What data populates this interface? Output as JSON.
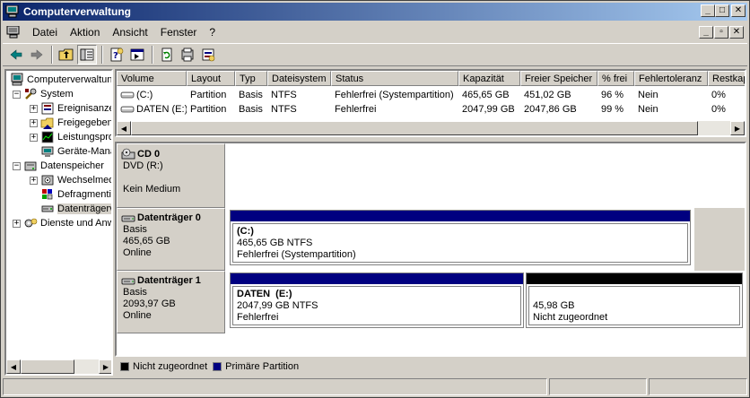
{
  "window": {
    "title": "Computerverwaltung",
    "controls": {
      "minimize": "_",
      "maximize": "□",
      "close": "✕"
    },
    "mdi_controls": {
      "minimize": "_",
      "restore": "▫",
      "close": "✕"
    }
  },
  "menu": [
    "Datei",
    "Aktion",
    "Ansicht",
    "Fenster",
    "?"
  ],
  "toolbar_icons": [
    "back-icon",
    "forward-icon",
    "up-folder-icon",
    "show-tree-icon",
    "properties-icon",
    "export-icon",
    "refresh-icon",
    "help-icon",
    "settings-icon"
  ],
  "tree": {
    "items": [
      {
        "label": "Computerverwaltung (Lokal)",
        "level": 0,
        "expander": "",
        "icon": "computer-icon"
      },
      {
        "label": "System",
        "level": 1,
        "expander": "−",
        "icon": "tools-icon"
      },
      {
        "label": "Ereignisanzeige",
        "level": 2,
        "expander": "+",
        "icon": "event-viewer-icon"
      },
      {
        "label": "Freigegebene Ordner",
        "level": 2,
        "expander": "+",
        "icon": "shared-folder-icon"
      },
      {
        "label": "Leistungsprotokolle und Warnungen",
        "level": 2,
        "expander": "+",
        "icon": "performance-icon"
      },
      {
        "label": "Geräte-Manager",
        "level": 2,
        "expander": "",
        "icon": "device-manager-icon"
      },
      {
        "label": "Datenspeicher",
        "level": 1,
        "expander": "−",
        "icon": "storage-icon"
      },
      {
        "label": "Wechselmedien",
        "level": 2,
        "expander": "+",
        "icon": "removable-media-icon"
      },
      {
        "label": "Defragmentierung",
        "level": 2,
        "expander": "",
        "icon": "defrag-icon"
      },
      {
        "label": "Datenträgerverwaltung",
        "level": 2,
        "expander": "",
        "icon": "disk-management-icon"
      },
      {
        "label": "Dienste und Anwendungen",
        "level": 1,
        "expander": "+",
        "icon": "services-icon"
      }
    ]
  },
  "volume_list": {
    "columns": [
      "Volume",
      "Layout",
      "Typ",
      "Dateisystem",
      "Status",
      "Kapazität",
      "Freier Speicher",
      "% frei",
      "Fehlertoleranz",
      "Restkapazität"
    ],
    "rows": [
      [
        "(C:)",
        "Partition",
        "Basis",
        "NTFS",
        "Fehlerfrei (Systempartition)",
        "465,65 GB",
        "451,02 GB",
        "96 %",
        "Nein",
        "0%"
      ],
      [
        "DATEN (E:)",
        "Partition",
        "Basis",
        "NTFS",
        "Fehlerfrei",
        "2047,99 GB",
        "2047,86 GB",
        "99 %",
        "Nein",
        "0%"
      ]
    ]
  },
  "disks": [
    {
      "name": "CD 0",
      "icon": "cdrom-icon",
      "lines": [
        "DVD (R:)",
        "",
        "Kein Medium"
      ],
      "partitions": []
    },
    {
      "name": "Datenträger 0",
      "icon": "disk-icon",
      "lines": [
        "Basis",
        "465,65 GB",
        "Online"
      ],
      "partitions": [
        {
          "name": "(C:)",
          "size": "465,65 GB NTFS",
          "status": "Fehlerfrei (Systempartition)",
          "kind": "primary"
        }
      ]
    },
    {
      "name": "Datenträger 1",
      "icon": "disk-icon",
      "lines": [
        "Basis",
        "2093,97 GB",
        "Online"
      ],
      "partitions": [
        {
          "name": "DATEN  (E:)",
          "size": "2047,99 GB NTFS",
          "status": "Fehlerfrei",
          "kind": "primary"
        },
        {
          "name": "",
          "size": "45,98 GB",
          "status": "Nicht zugeordnet",
          "kind": "unallocated"
        }
      ]
    }
  ],
  "legend": [
    {
      "label": "Nicht zugeordnet",
      "color": "#000000"
    },
    {
      "label": "Primäre Partition",
      "color": "#000080"
    }
  ],
  "colors": {
    "title_start": "#0a246a",
    "title_end": "#a6caf0",
    "primary_partition": "#000080",
    "unallocated": "#000000"
  }
}
